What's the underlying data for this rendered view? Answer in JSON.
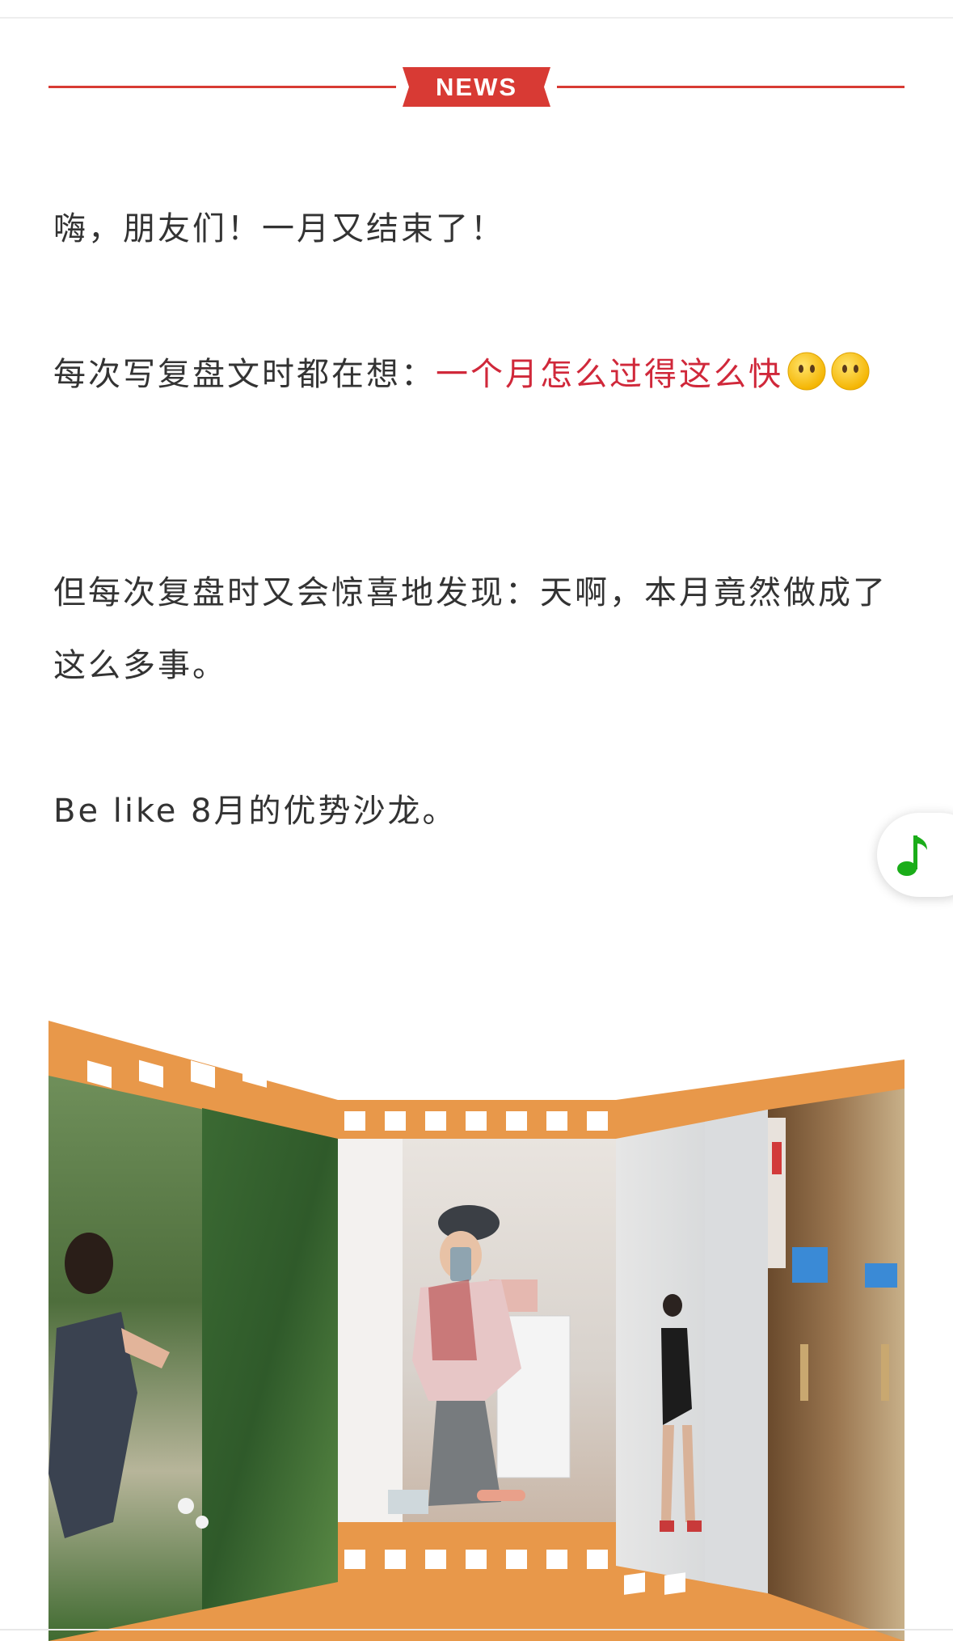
{
  "header": {
    "badge_label": "NEWS",
    "accent_color": "#d83a34"
  },
  "article": {
    "p1": "嗨，朋友们！一月又结束了！",
    "p2_prefix": "每次写复盘文时都在想：",
    "p2_highlight": "一个月怎么过得这么快",
    "p2_emoji": "face-without-mouth-emoji",
    "p3": "但每次复盘时又会惊喜地发现：天啊，本月竟然做成了这么多事。",
    "p4": "Be like 8月的优势沙龙。",
    "highlight_color": "#d0283a"
  },
  "floating": {
    "music_icon": "music-note-icon",
    "music_color": "#1aad19"
  },
  "film": {
    "frame_color": "#e8984a",
    "photos": [
      "photo-woman-in-park",
      "photo-forest-trees",
      "photo-mirror-selfie-bedroom",
      "photo-mirror-selfie-wardrobe",
      "photo-elevator-hall"
    ]
  }
}
